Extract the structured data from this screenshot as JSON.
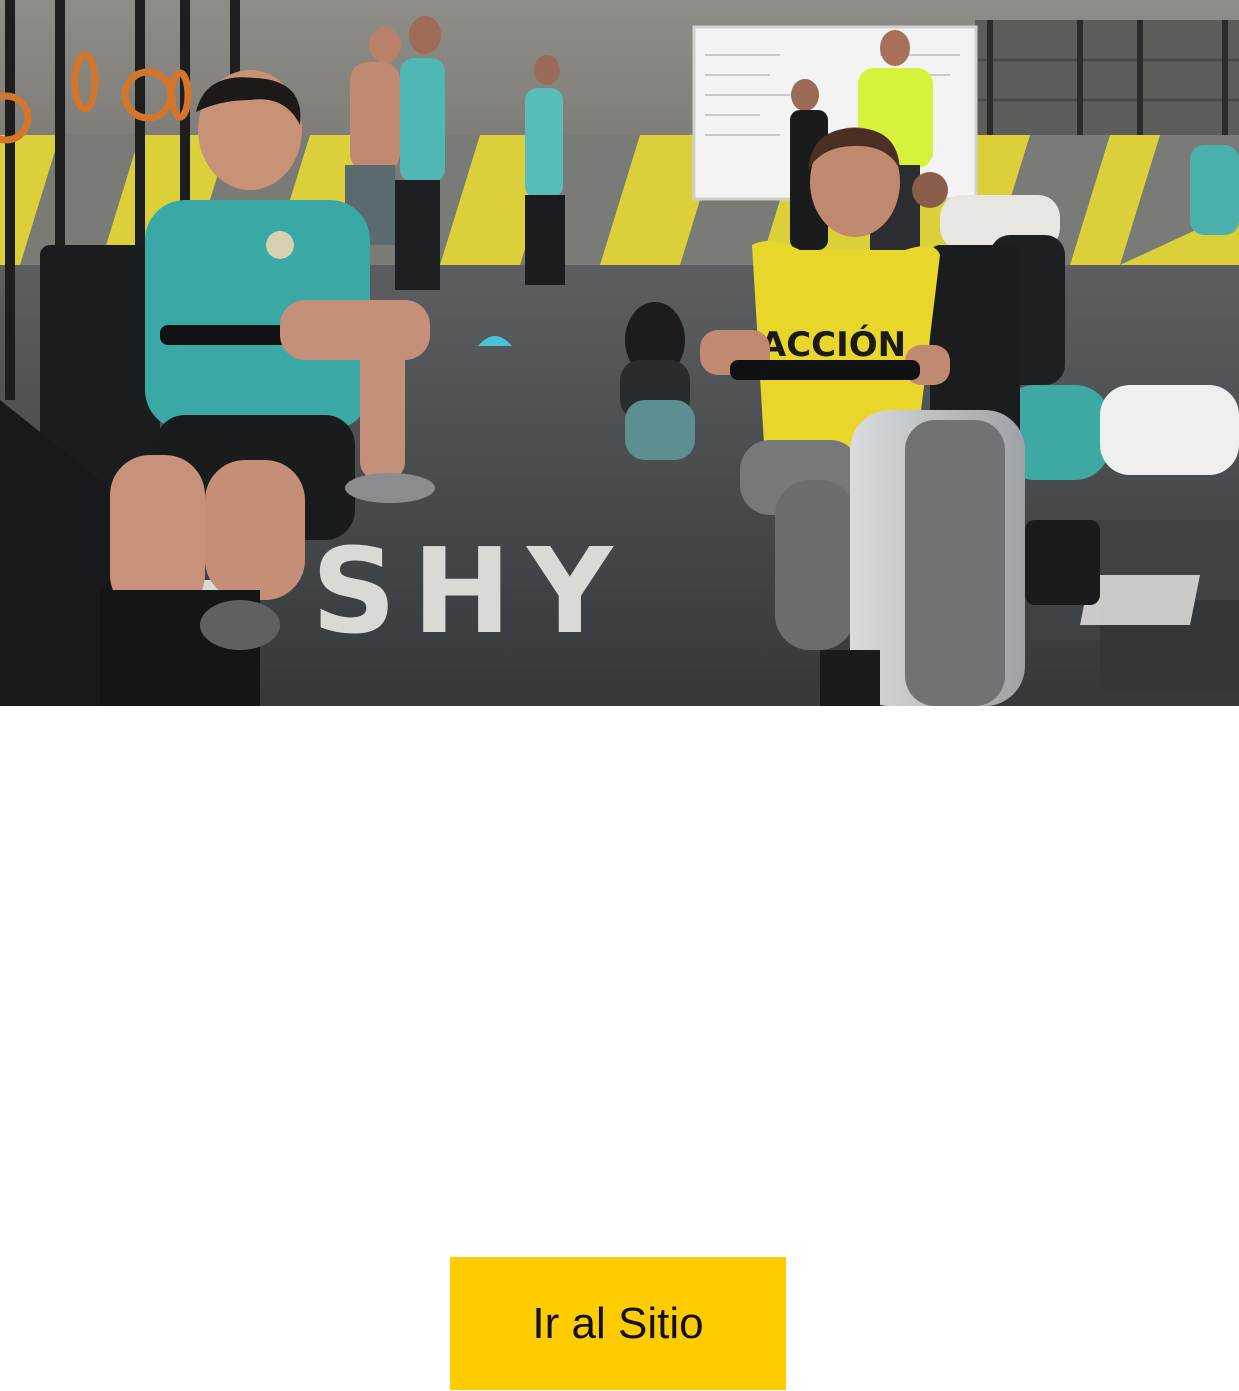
{
  "hero": {
    "shirt_text": "ACCIÓN",
    "floor_text": "SHY"
  },
  "cta": {
    "label": "Ir al Sitio"
  },
  "colors": {
    "cta_background": "#ffcc00",
    "cta_text": "#111111",
    "accent_yellow": "#e8d62a",
    "accent_teal": "#3cb8b0"
  }
}
